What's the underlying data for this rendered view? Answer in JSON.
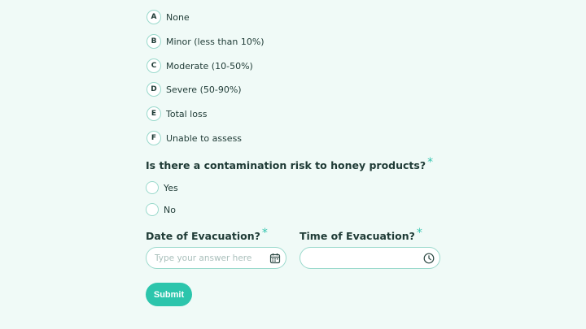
{
  "damage_question": {
    "options": [
      {
        "letter": "A",
        "label": "None"
      },
      {
        "letter": "B",
        "label": "Minor (less than 10%)"
      },
      {
        "letter": "C",
        "label": "Moderate (10-50%)"
      },
      {
        "letter": "D",
        "label": "Severe (50-90%)"
      },
      {
        "letter": "E",
        "label": "Total loss"
      },
      {
        "letter": "F",
        "label": "Unable to assess"
      }
    ]
  },
  "contamination_question": {
    "title": "Is there a contamination risk to honey products?",
    "required_mark": "*",
    "options": [
      "Yes",
      "No"
    ]
  },
  "date_field": {
    "label": "Date of Evacuation?",
    "required_mark": "*",
    "placeholder": "Type your answer here",
    "icon": "calendar-icon"
  },
  "time_field": {
    "label": "Time of Evacuation?",
    "required_mark": "*",
    "placeholder": "",
    "icon": "clock-icon"
  },
  "submit_label": "Submit",
  "colors": {
    "background": "#f0faf7",
    "accent": "#2cc5ac",
    "border": "#9ad9cc",
    "text": "#1f3b36"
  }
}
